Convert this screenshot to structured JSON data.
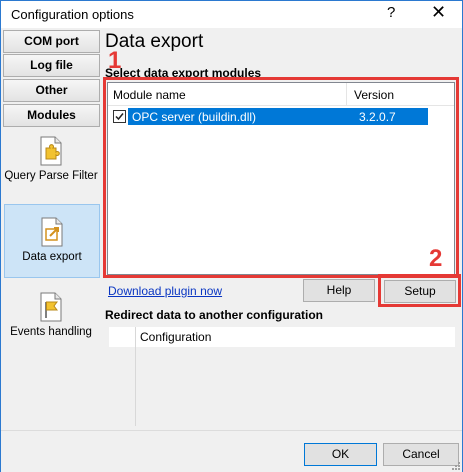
{
  "window": {
    "title": "Configuration options",
    "help_glyph": "?",
    "close_glyph": "✕"
  },
  "sidebar": {
    "buttons": [
      {
        "label": "COM port"
      },
      {
        "label": "Log file"
      },
      {
        "label": "Other"
      },
      {
        "label": "Modules"
      }
    ],
    "modules": [
      {
        "label": "Query Parse Filter",
        "icon": "puzzle-page-icon"
      },
      {
        "label": "Data export",
        "icon": "export-page-icon"
      },
      {
        "label": "Events handling",
        "icon": "flag-page-icon"
      }
    ]
  },
  "main": {
    "title": "Data export",
    "modules_section": "Select data export modules",
    "list": {
      "col_name": "Module name",
      "col_version": "Version",
      "rows": [
        {
          "checked": true,
          "name": "OPC server (buildin.dll)",
          "version": "3.2.0.7"
        }
      ]
    },
    "download_link": "Download plugin now",
    "help_button": "Help",
    "setup_button": "Setup",
    "redirect_section": "Redirect data to another configuration",
    "redirect_col": "Configuration",
    "annotations": [
      "1",
      "2"
    ]
  },
  "footer": {
    "ok_label": "OK",
    "cancel_label": "Cancel"
  },
  "colors": {
    "accent": "#0078d7",
    "annotation": "#e53935",
    "selected_module": "#cde4f7",
    "link": "#0a36c2"
  }
}
